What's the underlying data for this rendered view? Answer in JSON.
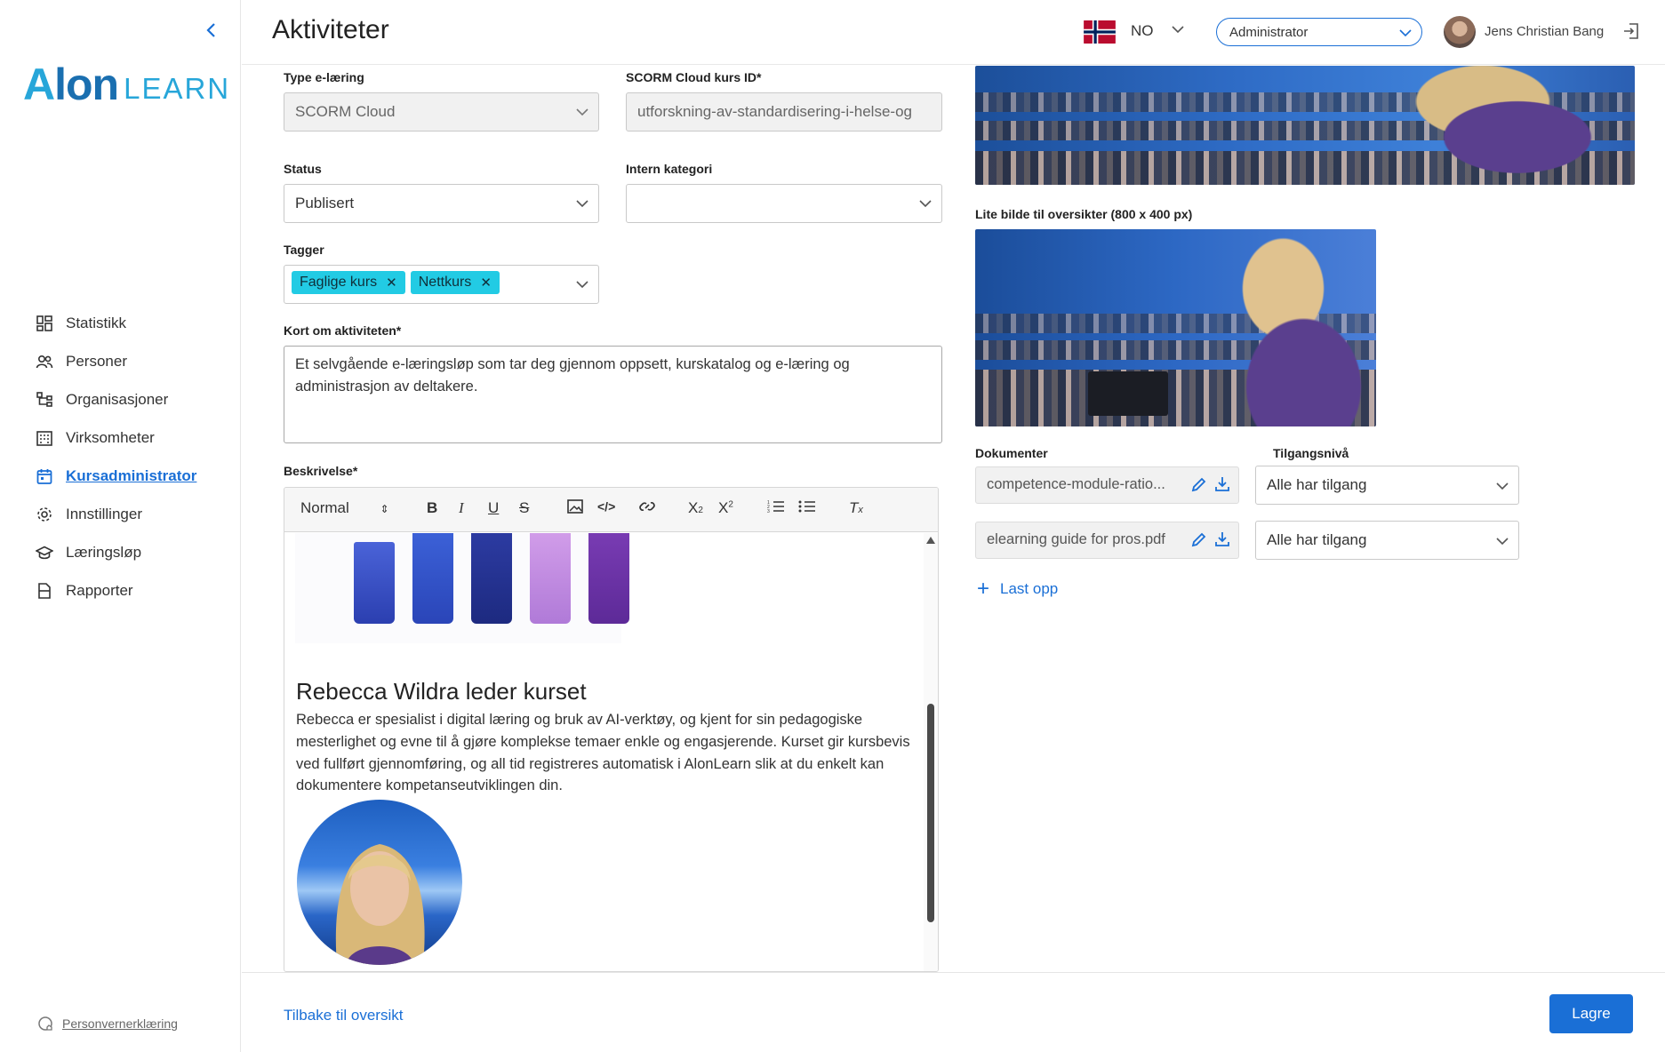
{
  "header": {
    "title": "Aktiviteter",
    "language": "NO",
    "role": "Administrator",
    "user_name": "Jens Christian Bang"
  },
  "sidebar": {
    "logo_part1": "Alon",
    "logo_part2": "LEARN",
    "items": [
      {
        "label": "Statistikk",
        "icon": "dashboard-icon",
        "active": false
      },
      {
        "label": "Personer",
        "icon": "people-icon",
        "active": false
      },
      {
        "label": "Organisasjoner",
        "icon": "org-chart-icon",
        "active": false
      },
      {
        "label": "Virksomheter",
        "icon": "building-icon",
        "active": false
      },
      {
        "label": "Kursadministrator",
        "icon": "calendar-icon",
        "active": true
      },
      {
        "label": "Innstillinger",
        "icon": "gear-icon",
        "active": false
      },
      {
        "label": "Læringsløp",
        "icon": "graduation-cap-icon",
        "active": false
      },
      {
        "label": "Rapporter",
        "icon": "report-icon",
        "active": false
      }
    ],
    "privacy": "Personvernerklæring"
  },
  "form": {
    "type_label": "Type e-læring",
    "type_value": "SCORM Cloud",
    "scorm_label": "SCORM Cloud kurs ID*",
    "scorm_value": "utforskning-av-standardisering-i-helse-og",
    "status_label": "Status",
    "status_value": "Publisert",
    "category_label": "Intern kategori",
    "category_value": "",
    "tags_label": "Tagger",
    "tags": [
      "Faglige kurs",
      "Nettkurs"
    ],
    "short_label": "Kort om aktiviteten*",
    "short_value": "Et selvgående e-læringsløp som tar deg gjennom oppsett, kurskatalog og e-læring og administrasjon av deltakere.",
    "desc_label": "Beskrivelse*"
  },
  "editor": {
    "format": "Normal",
    "heading": "Rebecca Wildra leder kurset",
    "paragraph": "Rebecca er spesialist i digital læring og bruk av AI-verktøy, og kjent for sin pedagogiske mesterlighet og evne til å gjøre komplekse temaer enkle og engasjerende. Kurset gir kursbevis ved fullført gjennomføring, og all tid registreres automatisk i AlonLearn slik at du enkelt kan dokumentere kompetanseutviklingen din."
  },
  "media": {
    "small_image_label": "Lite bilde til oversikter (800 x 400 px)"
  },
  "documents": {
    "docs_label": "Dokumenter",
    "access_label": "Tilgangsnivå",
    "items": [
      {
        "name": "competence-module-ratio...",
        "access": "Alle har tilgang"
      },
      {
        "name": "elearning guide for pros.pdf",
        "access": "Alle har tilgang"
      }
    ],
    "upload_label": "Last opp"
  },
  "footer": {
    "back": "Tilbake til oversikt",
    "save": "Lagre"
  },
  "colors": {
    "accent": "#1a6fd6",
    "chip": "#22cbe4",
    "logo_dark": "#1a6fb0",
    "logo_light": "#27a6d9"
  }
}
